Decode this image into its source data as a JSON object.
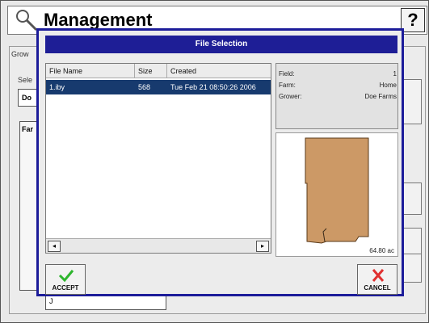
{
  "app": {
    "title": "Management",
    "help_label": "?",
    "bg_labels": {
      "grower": "Grow",
      "select": "Sele",
      "select_value": "Do",
      "farm_header": "Far",
      "bottom_value": "J"
    }
  },
  "dialog": {
    "title": "File Selection",
    "columns": {
      "name": "File Name",
      "size": "Size",
      "created": "Created"
    },
    "rows": [
      {
        "name": "1.iby",
        "size": "568",
        "created": "Tue Feb 21 08:50:26 2006"
      }
    ],
    "info": {
      "field_label": "Field:",
      "field_value": "1",
      "farm_label": "Farm:",
      "farm_value": "Home",
      "grower_label": "Grower:",
      "grower_value": "Doe Farms"
    },
    "preview_area": "64.80 ac",
    "accept_label": "ACCEPT",
    "cancel_label": "CANCEL"
  },
  "colors": {
    "accent": "#1e1e96",
    "selection": "#173a6e",
    "field_fill": "#cc9966"
  }
}
